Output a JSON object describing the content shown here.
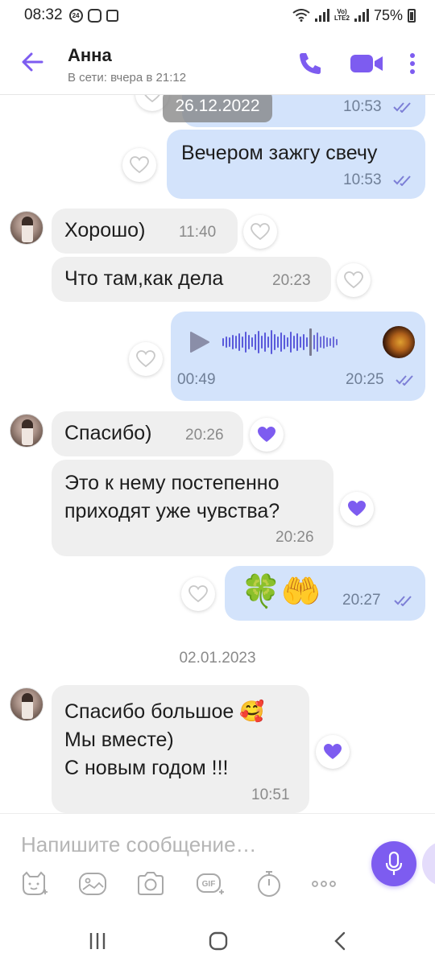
{
  "status_bar": {
    "time": "08:32",
    "notif_badge": "24",
    "battery": "75%",
    "network_label_top": "Vo)",
    "network_label_bottom": "LTE2"
  },
  "header": {
    "contact_name": "Анна",
    "status": "В сети: вчера в 21:12",
    "icons": [
      "back-arrow-icon",
      "phone-icon",
      "video-camera-icon",
      "more-vert-icon"
    ]
  },
  "messages": {
    "date_top": "26.12.2022",
    "m1_time": "10:53",
    "m2_text": "Вечером зажгу свечу",
    "m2_time": "10:53",
    "m3_text": "Хорошо)",
    "m3_time": "11:40",
    "m4_text": "Что там,как дела",
    "m4_time": "20:23",
    "voice_duration": "00:49",
    "voice_time": "20:25",
    "voice_progress": 0.76,
    "m6_text": "Спасибо)",
    "m6_time": "20:26",
    "m7_line1": "Это к нему постепенно",
    "m7_line2": "приходят уже чувства?",
    "m7_time": "20:26",
    "m8_emoji": "🍀🤲",
    "m8_time": "20:27",
    "date_sep": "02.01.2023",
    "m9_line1": "Спасибо большое 🥰",
    "m9_line2": "Мы вместе)",
    "m9_line3": "С новым годом !!!",
    "m9_time": "10:51"
  },
  "input": {
    "placeholder": "Напишите сообщение…",
    "tools": [
      "sticker-icon",
      "gallery-icon",
      "camera-icon",
      "gif-icon",
      "timer-icon",
      "more-horiz-icon"
    ]
  },
  "colors": {
    "accent": "#7d5cf0",
    "outgoing_bubble": "#d3e3fb",
    "incoming_bubble": "#efefef"
  }
}
